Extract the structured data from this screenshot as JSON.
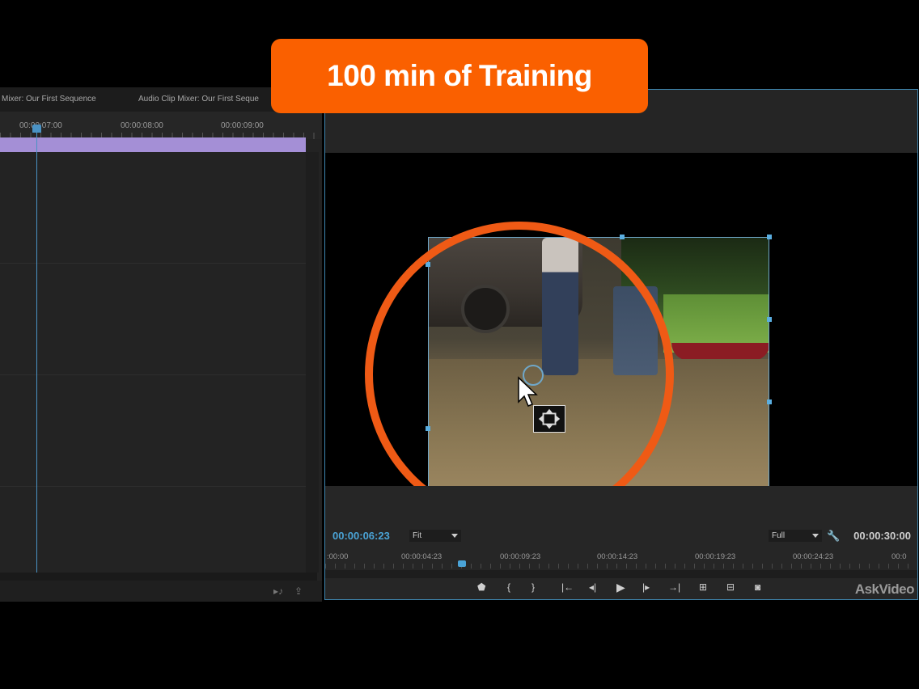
{
  "banner": {
    "text": "100 min of Training"
  },
  "left_panel": {
    "tabs": [
      "Mixer: Our First Sequence",
      "Audio Clip Mixer: Our First Seque"
    ],
    "ruler_times": [
      "00:00:07:00",
      "00:00:08:00",
      "00:00:09:00"
    ],
    "clip_color": "#a48fd6"
  },
  "monitor": {
    "current_time": "00:00:06:23",
    "fit_label": "Fit",
    "quality_label": "Full",
    "duration": "00:00:30:00",
    "ruler_times": [
      ":00:00",
      "00:00:04:23",
      "00:00:09:23",
      "00:00:14:23",
      "00:00:19:23",
      "00:00:24:23",
      "00:0"
    ],
    "transport": {
      "marker": "⬟",
      "mark_in": "{",
      "mark_out": "}",
      "go_to_in": "|←",
      "step_back": "◂|",
      "play": "▶",
      "step_forward": "|▸",
      "go_to_out": "→|",
      "insert": "⊞",
      "overwrite": "⊟",
      "export_frame": "◙"
    },
    "accent_color": "#4aa3d6"
  },
  "watermark": "AskVideo"
}
